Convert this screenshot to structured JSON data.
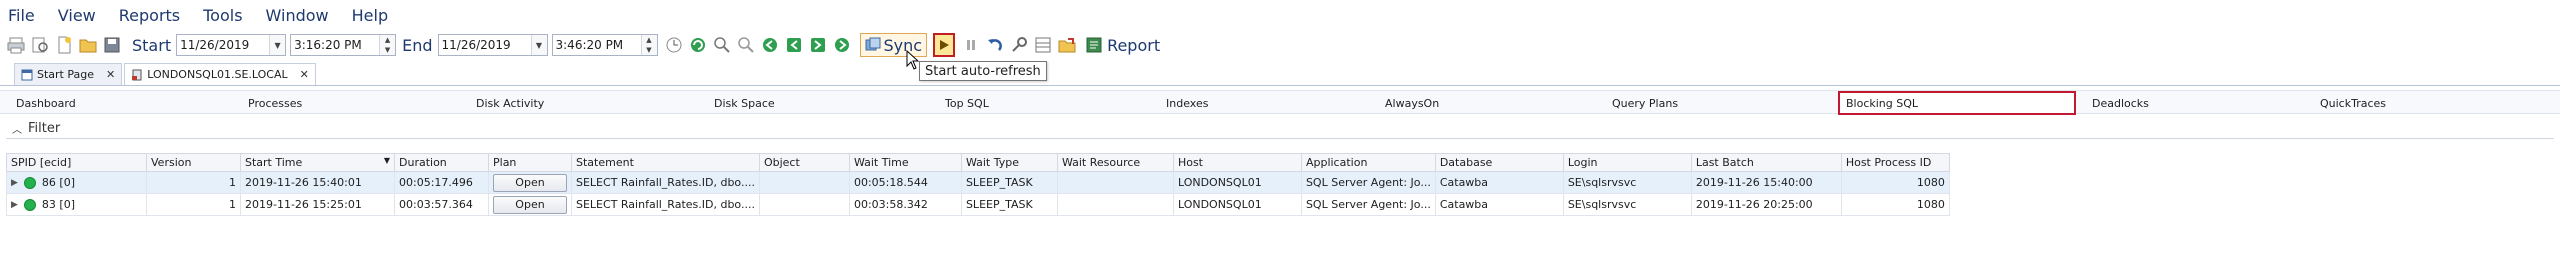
{
  "menu": [
    "File",
    "View",
    "Reports",
    "Tools",
    "Window",
    "Help"
  ],
  "toolbar": {
    "start_label": "Start",
    "start_date": "11/26/2019",
    "start_time": "3:16:20 PM",
    "end_label": "End",
    "end_date": "11/26/2019",
    "end_time": "3:46:20 PM",
    "sync_label": "Sync",
    "report_label": "Report",
    "tooltip": "Start auto-refresh"
  },
  "doc_tabs": [
    {
      "label": "Start Page",
      "active": false
    },
    {
      "label": "LONDONSQL01.SE.LOCAL",
      "active": true
    }
  ],
  "function_tabs": [
    "Dashboard",
    "Processes",
    "Disk Activity",
    "Disk Space",
    "Top SQL",
    "Indexes",
    "AlwaysOn",
    "Query Plans",
    "Blocking SQL",
    "Deadlocks",
    "QuickTraces"
  ],
  "selected_function_tab": "Blocking SQL",
  "filter": {
    "label": "Filter"
  },
  "grid": {
    "columns": [
      "SPID [ecid]",
      "Version",
      "Start Time",
      "Duration",
      "Plan",
      "Statement",
      "Object",
      "Wait Time",
      "Wait Type",
      "Wait Resource",
      "Host",
      "Application",
      "Database",
      "Login",
      "Last Batch",
      "Host Process ID"
    ],
    "rows": [
      {
        "spid": "86 [0]",
        "version": "1",
        "start_time": "2019-11-26 15:40:01",
        "duration": "00:05:17.496",
        "plan": "Open",
        "statement": "SELECT Rainfall_Rates.ID, dbo....",
        "object": "",
        "wait_time": "00:05:18.544",
        "wait_type": "SLEEP_TASK",
        "wait_resource": "",
        "host": "LONDONSQL01",
        "application": "SQL Server Agent: Jo...",
        "database": "Catawba",
        "login": "SE\\sqlsrvsvc",
        "last_batch": "2019-11-26 15:40:00",
        "host_pid": "1080"
      },
      {
        "spid": "83 [0]",
        "version": "1",
        "start_time": "2019-11-26 15:25:01",
        "duration": "00:03:57.364",
        "plan": "Open",
        "statement": "SELECT Rainfall_Rates.ID, dbo....",
        "object": "",
        "wait_time": "00:03:58.342",
        "wait_type": "SLEEP_TASK",
        "wait_resource": "",
        "host": "LONDONSQL01",
        "application": "SQL Server Agent: Jo...",
        "database": "Catawba",
        "login": "SE\\sqlsrvsvc",
        "last_batch": "2019-11-26 20:25:00",
        "host_pid": "1080"
      }
    ]
  },
  "colors": {
    "accent": "#1e3a6e",
    "selected_border": "#c21830",
    "status_green": "#22b14c"
  }
}
